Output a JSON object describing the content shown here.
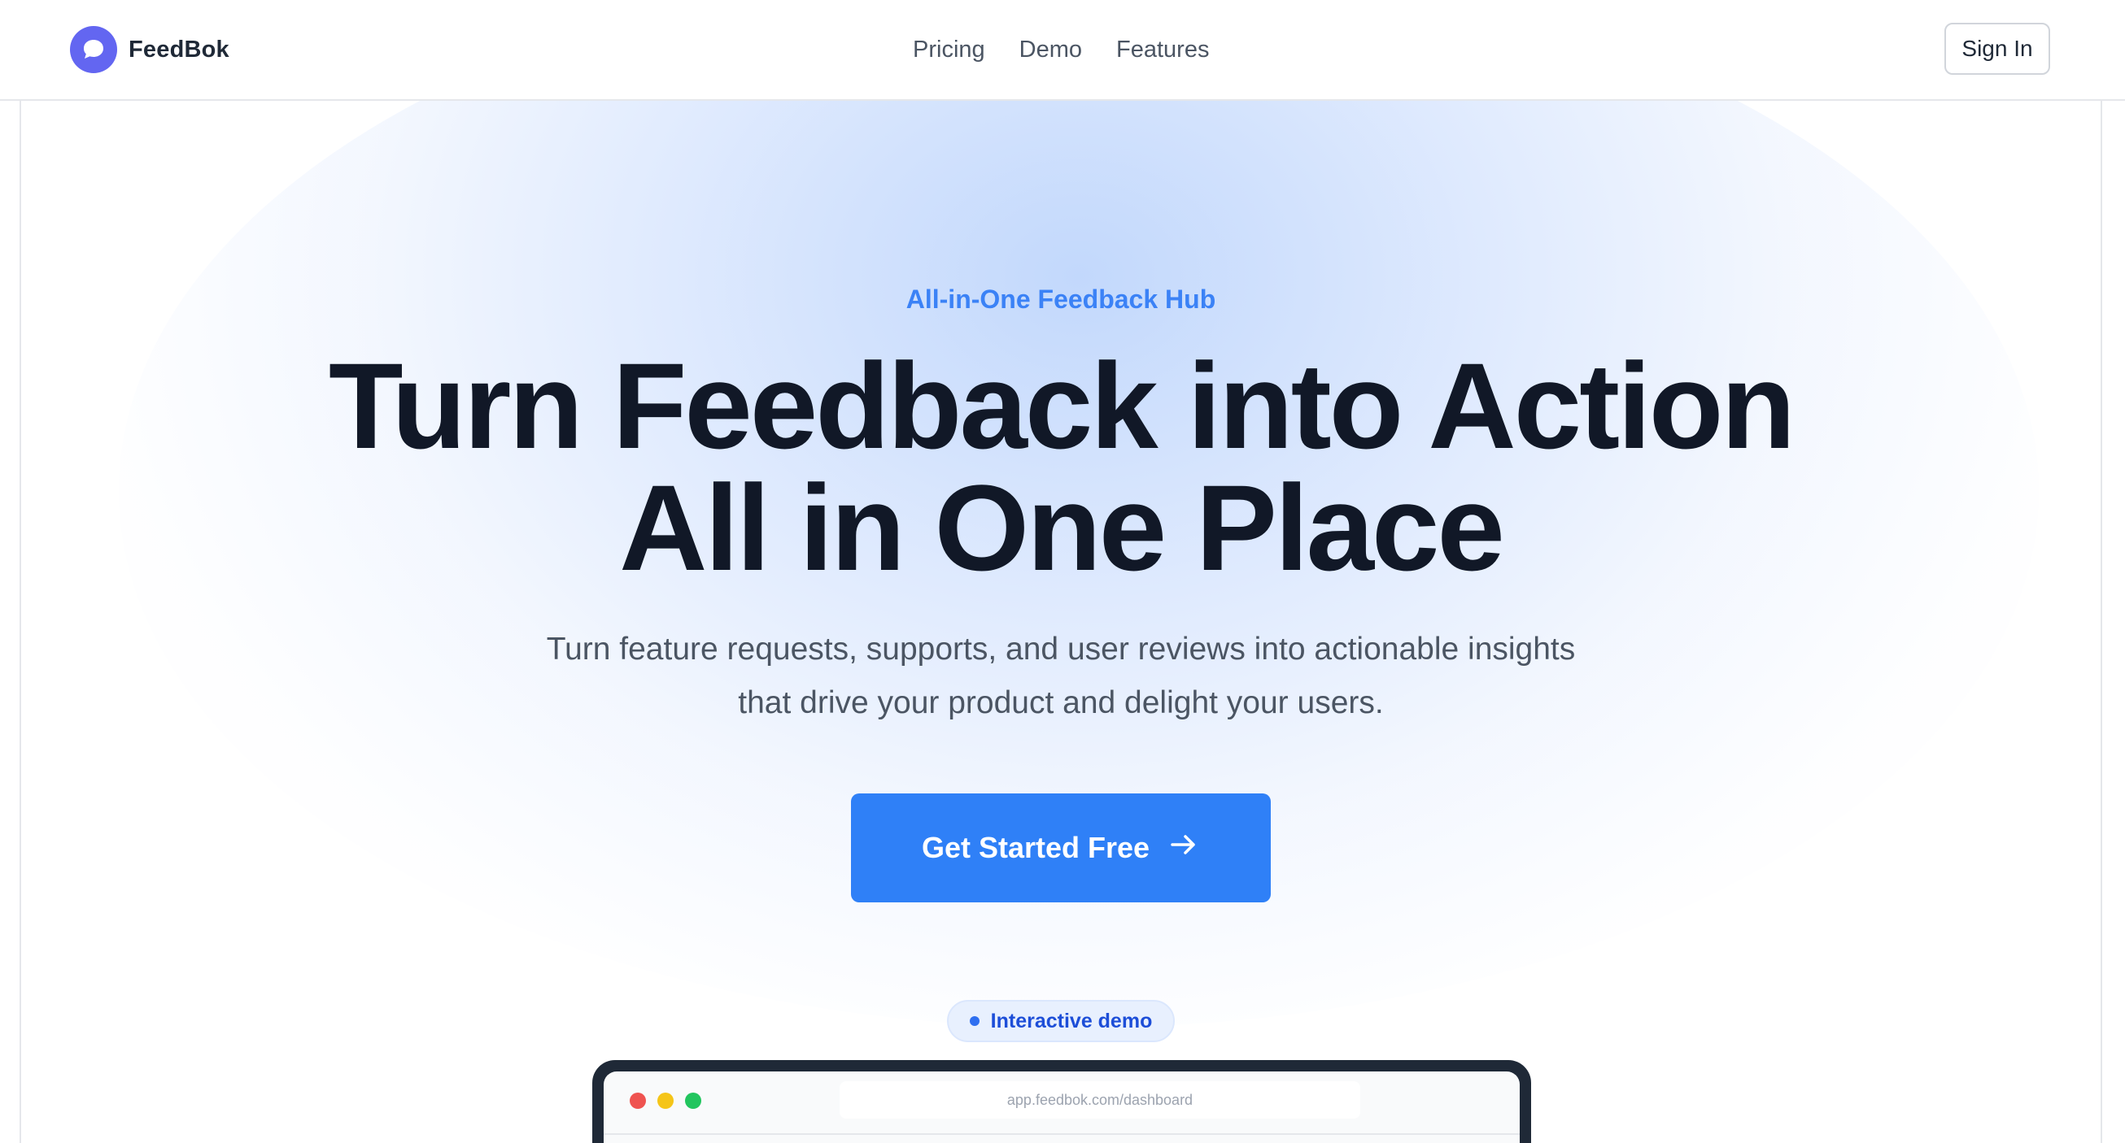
{
  "nav": {
    "brand_name": "FeedBok",
    "links": [
      {
        "label": "Pricing"
      },
      {
        "label": "Demo"
      },
      {
        "label": "Features"
      }
    ],
    "sign_in_label": "Sign In"
  },
  "hero": {
    "eyebrow": "All-in-One Feedback Hub",
    "headline_line1": "Turn Feedback into Action",
    "headline_line2": "All in One Place",
    "subtitle_line1": "Turn feature requests, supports, and user reviews into actionable insights",
    "subtitle_line2": "that drive your product and delight your users.",
    "cta_label": "Get Started Free"
  },
  "demo": {
    "badge_label": "Interactive demo",
    "url": "app.feedbok.com/dashboard"
  },
  "icons": {
    "logo": "chat-bubble-icon",
    "cta": "arrow-right-icon"
  },
  "colors": {
    "brand": "#6366f1",
    "accent": "#2f80f7",
    "eyebrow": "#3b82f6",
    "headline": "#111827"
  }
}
